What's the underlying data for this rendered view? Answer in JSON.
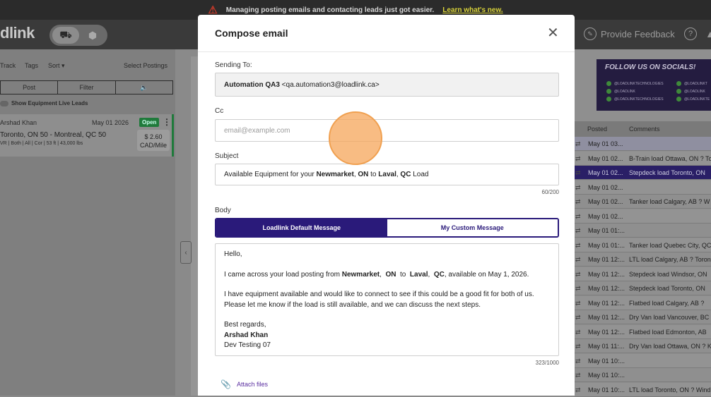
{
  "banner": {
    "text": "Managing posting emails and contacting leads just got easier.",
    "link": "Learn what's new."
  },
  "app": {
    "logo": "dlink",
    "feedback": "Provide Feedback",
    "help": "?"
  },
  "left": {
    "tools": {
      "track": "Track",
      "tags": "Tags",
      "sort": "Sort ▾",
      "select": "Select Postings"
    },
    "buttons": {
      "post": "Post",
      "filter": "Filter",
      "sound": "🔈"
    },
    "toggle": "Show Equipment Live Leads",
    "card": {
      "name": "Arshad Khan",
      "date": "May  01  2026",
      "status": "Open",
      "route": "Toronto, ON 50  -  Montreal, QC 50",
      "meta": "VR | Both | All | Cor | 53 ft | 43,000 lbs",
      "rate": "$  2.60",
      "unit": "CAD/Mile"
    }
  },
  "right": {
    "social_title": "FOLLOW US ON SOCIALS!",
    "handles": [
      "@LOADLINKTECHNOLOGIES",
      "@LOADLINK",
      "@LOADLINKTECHNOLOGIES",
      "@LOADLINKT",
      "@LOADLINK",
      "@LOADLINKTE"
    ],
    "headers": {
      "posted": "Posted",
      "comments": "Comments"
    },
    "rows": [
      {
        "posted": "May 01 03...",
        "comment": ""
      },
      {
        "posted": "May 01 02...",
        "comment": "B-Train load Ottawa, ON ? To"
      },
      {
        "posted": "May 01 02...",
        "comment": "Stepdeck load Toronto, ON"
      },
      {
        "posted": "May 01 02...",
        "comment": ""
      },
      {
        "posted": "May 01 02...",
        "comment": "Tanker load Calgary, AB ? W"
      },
      {
        "posted": "May 01 02...",
        "comment": ""
      },
      {
        "posted": "May 01 01:...",
        "comment": ""
      },
      {
        "posted": "May 01 01:...",
        "comment": "Tanker load Quebec City, QC"
      },
      {
        "posted": "May 01 12:...",
        "comment": "LTL load Calgary, AB ? Toron"
      },
      {
        "posted": "May 01 12:...",
        "comment": "Stepdeck load Windsor, ON"
      },
      {
        "posted": "May 01 12:...",
        "comment": "Stepdeck load Toronto, ON"
      },
      {
        "posted": "May 01 12:...",
        "comment": "Flatbed load Calgary, AB ?"
      },
      {
        "posted": "May 01 12:...",
        "comment": "Dry Van load Vancouver, BC"
      },
      {
        "posted": "May 01 12:...",
        "comment": "Flatbed load Edmonton, AB"
      },
      {
        "posted": "May 01 11:...",
        "comment": "Dry Van load Ottawa, ON ? K"
      },
      {
        "posted": "May 01 10:...",
        "comment": ""
      },
      {
        "posted": "May 01 10:...",
        "comment": ""
      },
      {
        "posted": "May 01 10:...",
        "comment": "LTL load Toronto, ON ? Wind"
      }
    ]
  },
  "modal": {
    "title": "Compose email",
    "sending_label": "Sending To:",
    "sending_name": "Automation QA3",
    "sending_email": "<qa.automation3@loadlink.ca>",
    "cc_label": "Cc",
    "cc_placeholder": "email@example.com",
    "subject_label": "Subject",
    "subject": {
      "pre": "Available Equipment for your ",
      "origin_city": "Newmarket",
      "sep1": ", ",
      "origin_prov": "ON",
      "to": " to ",
      "dest_city": "Laval",
      "sep2": ", ",
      "dest_prov": "QC",
      "post": " Load"
    },
    "subject_count": "60/200",
    "body_label": "Body",
    "tab_default": "Loadlink Default Message",
    "tab_custom": "My Custom Message",
    "body": {
      "greeting": "Hello,",
      "l2_pre": "I came across your load posting from ",
      "l2_city1": "Newmarket",
      "l2_sep1": ", ",
      "l2_prov1": "ON",
      "l2_to": " to ",
      "l2_city2": "Laval",
      "l2_sep2": ", ",
      "l2_prov2": "QC",
      "l2_post": ", available on May 1, 2026.",
      "l3a": "I have equipment available and would like to connect to see if this could be a good fit for both of us.",
      "l3b": "Please let me know if the load is still available, and we can discuss the next steps.",
      "regards": "Best regards,",
      "sig_name": "Arshad Khan",
      "sig_co": "Dev Testing 07"
    },
    "body_count": "323/1000",
    "attach": "Attach files"
  }
}
